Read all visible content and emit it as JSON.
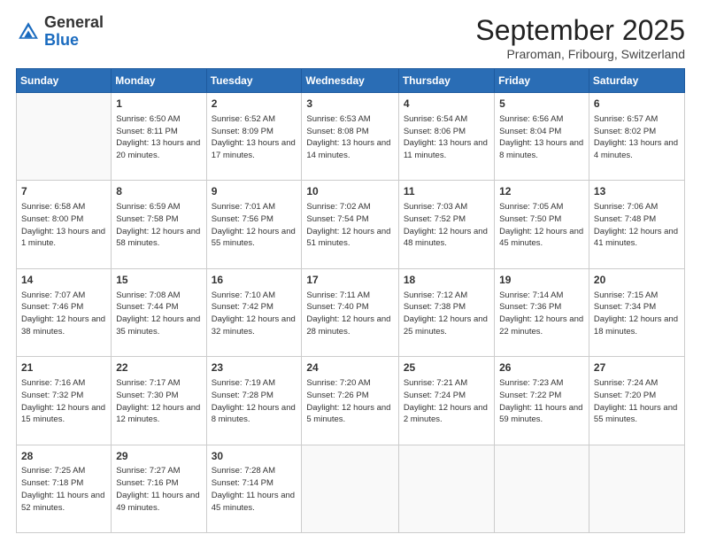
{
  "logo": {
    "general": "General",
    "blue": "Blue"
  },
  "header": {
    "month": "September 2025",
    "location": "Praroman, Fribourg, Switzerland"
  },
  "weekdays": [
    "Sunday",
    "Monday",
    "Tuesday",
    "Wednesday",
    "Thursday",
    "Friday",
    "Saturday"
  ],
  "weeks": [
    [
      {
        "day": "",
        "info": ""
      },
      {
        "day": "1",
        "info": "Sunrise: 6:50 AM\nSunset: 8:11 PM\nDaylight: 13 hours\nand 20 minutes."
      },
      {
        "day": "2",
        "info": "Sunrise: 6:52 AM\nSunset: 8:09 PM\nDaylight: 13 hours\nand 17 minutes."
      },
      {
        "day": "3",
        "info": "Sunrise: 6:53 AM\nSunset: 8:08 PM\nDaylight: 13 hours\nand 14 minutes."
      },
      {
        "day": "4",
        "info": "Sunrise: 6:54 AM\nSunset: 8:06 PM\nDaylight: 13 hours\nand 11 minutes."
      },
      {
        "day": "5",
        "info": "Sunrise: 6:56 AM\nSunset: 8:04 PM\nDaylight: 13 hours\nand 8 minutes."
      },
      {
        "day": "6",
        "info": "Sunrise: 6:57 AM\nSunset: 8:02 PM\nDaylight: 13 hours\nand 4 minutes."
      }
    ],
    [
      {
        "day": "7",
        "info": "Sunrise: 6:58 AM\nSunset: 8:00 PM\nDaylight: 13 hours\nand 1 minute."
      },
      {
        "day": "8",
        "info": "Sunrise: 6:59 AM\nSunset: 7:58 PM\nDaylight: 12 hours\nand 58 minutes."
      },
      {
        "day": "9",
        "info": "Sunrise: 7:01 AM\nSunset: 7:56 PM\nDaylight: 12 hours\nand 55 minutes."
      },
      {
        "day": "10",
        "info": "Sunrise: 7:02 AM\nSunset: 7:54 PM\nDaylight: 12 hours\nand 51 minutes."
      },
      {
        "day": "11",
        "info": "Sunrise: 7:03 AM\nSunset: 7:52 PM\nDaylight: 12 hours\nand 48 minutes."
      },
      {
        "day": "12",
        "info": "Sunrise: 7:05 AM\nSunset: 7:50 PM\nDaylight: 12 hours\nand 45 minutes."
      },
      {
        "day": "13",
        "info": "Sunrise: 7:06 AM\nSunset: 7:48 PM\nDaylight: 12 hours\nand 41 minutes."
      }
    ],
    [
      {
        "day": "14",
        "info": "Sunrise: 7:07 AM\nSunset: 7:46 PM\nDaylight: 12 hours\nand 38 minutes."
      },
      {
        "day": "15",
        "info": "Sunrise: 7:08 AM\nSunset: 7:44 PM\nDaylight: 12 hours\nand 35 minutes."
      },
      {
        "day": "16",
        "info": "Sunrise: 7:10 AM\nSunset: 7:42 PM\nDaylight: 12 hours\nand 32 minutes."
      },
      {
        "day": "17",
        "info": "Sunrise: 7:11 AM\nSunset: 7:40 PM\nDaylight: 12 hours\nand 28 minutes."
      },
      {
        "day": "18",
        "info": "Sunrise: 7:12 AM\nSunset: 7:38 PM\nDaylight: 12 hours\nand 25 minutes."
      },
      {
        "day": "19",
        "info": "Sunrise: 7:14 AM\nSunset: 7:36 PM\nDaylight: 12 hours\nand 22 minutes."
      },
      {
        "day": "20",
        "info": "Sunrise: 7:15 AM\nSunset: 7:34 PM\nDaylight: 12 hours\nand 18 minutes."
      }
    ],
    [
      {
        "day": "21",
        "info": "Sunrise: 7:16 AM\nSunset: 7:32 PM\nDaylight: 12 hours\nand 15 minutes."
      },
      {
        "day": "22",
        "info": "Sunrise: 7:17 AM\nSunset: 7:30 PM\nDaylight: 12 hours\nand 12 minutes."
      },
      {
        "day": "23",
        "info": "Sunrise: 7:19 AM\nSunset: 7:28 PM\nDaylight: 12 hours\nand 8 minutes."
      },
      {
        "day": "24",
        "info": "Sunrise: 7:20 AM\nSunset: 7:26 PM\nDaylight: 12 hours\nand 5 minutes."
      },
      {
        "day": "25",
        "info": "Sunrise: 7:21 AM\nSunset: 7:24 PM\nDaylight: 12 hours\nand 2 minutes."
      },
      {
        "day": "26",
        "info": "Sunrise: 7:23 AM\nSunset: 7:22 PM\nDaylight: 11 hours\nand 59 minutes."
      },
      {
        "day": "27",
        "info": "Sunrise: 7:24 AM\nSunset: 7:20 PM\nDaylight: 11 hours\nand 55 minutes."
      }
    ],
    [
      {
        "day": "28",
        "info": "Sunrise: 7:25 AM\nSunset: 7:18 PM\nDaylight: 11 hours\nand 52 minutes."
      },
      {
        "day": "29",
        "info": "Sunrise: 7:27 AM\nSunset: 7:16 PM\nDaylight: 11 hours\nand 49 minutes."
      },
      {
        "day": "30",
        "info": "Sunrise: 7:28 AM\nSunset: 7:14 PM\nDaylight: 11 hours\nand 45 minutes."
      },
      {
        "day": "",
        "info": ""
      },
      {
        "day": "",
        "info": ""
      },
      {
        "day": "",
        "info": ""
      },
      {
        "day": "",
        "info": ""
      }
    ]
  ]
}
